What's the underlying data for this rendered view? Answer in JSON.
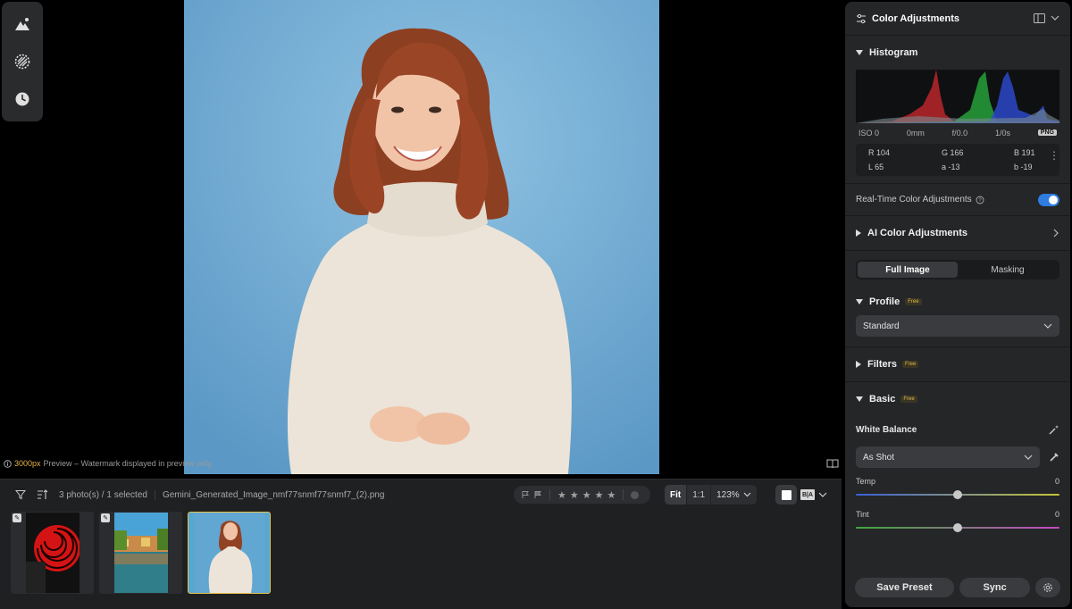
{
  "preview_note": {
    "px": "3000px",
    "rest": " Preview – Watermark displayed in preview only."
  },
  "filmstrip": {
    "photo_count": "3 photo(s) / 1 selected",
    "filename": "Gemini_Generated_Image_nmf77snmf77snmf7_(2).png",
    "zoom_fit": "Fit",
    "zoom_one_to_one": "1:1",
    "zoom_percent": "123%",
    "ba_label": "B|A",
    "rating_stars": 0,
    "selected_index": 2
  },
  "panel": {
    "title": "Color Adjustments",
    "histogram": {
      "title": "Histogram",
      "iso": "ISO 0",
      "focal": "0mm",
      "aperture": "f/0.0",
      "shutter": "1/0s",
      "format": "PNG",
      "r": "R 104",
      "g": "G 166",
      "b": "B 191",
      "l": "L 65",
      "a": "a -13",
      "bb": "b -19"
    },
    "realtime_label": "Real-Time Color Adjustments",
    "realtime_enabled": true,
    "ai_title": "AI Color Adjustments",
    "tabs": [
      "Full Image",
      "Masking"
    ],
    "profile_title": "Profile",
    "profile_value": "Standard",
    "filters_title": "Filters",
    "basic_title": "Basic",
    "free_badge": "Free",
    "white_balance_label": "White Balance",
    "white_balance_value": "As Shot",
    "temp_label": "Temp",
    "temp_value": "0",
    "tint_label": "Tint",
    "tint_value": "0",
    "save_preset": "Save Preset",
    "sync": "Sync"
  },
  "colors": {
    "accent": "#2f7de0",
    "free_badge": "#e1b84a",
    "selected_border": "#e5c24a",
    "photo_bg": "#6aa6cf"
  }
}
